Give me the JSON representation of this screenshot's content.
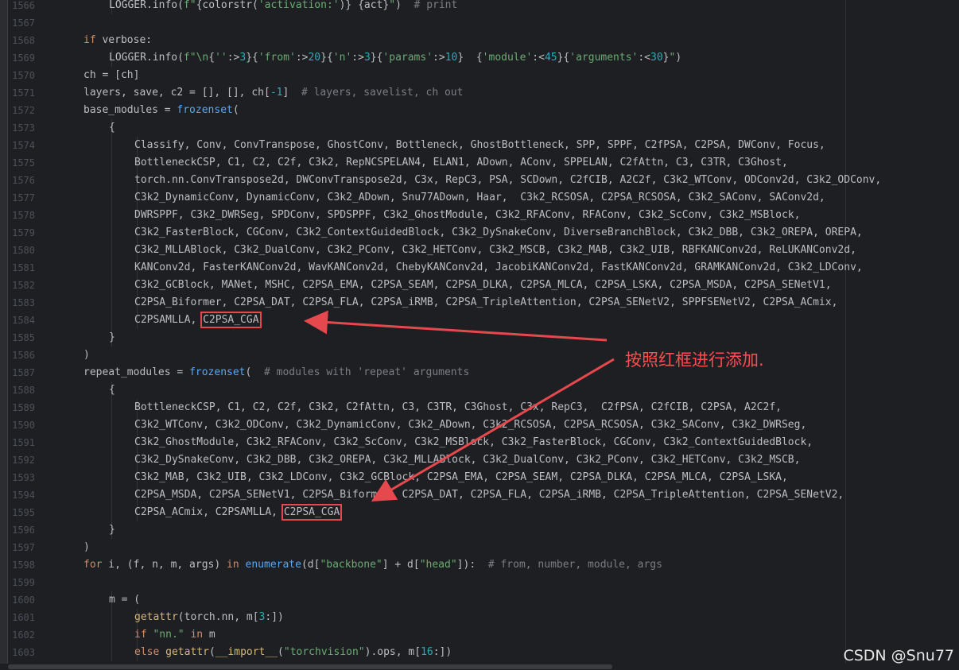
{
  "editor": {
    "lines": [
      {
        "n": "1566",
        "i": 2,
        "t": [
          [
            "LOGGER.info(",
            ""
          ],
          [
            "f\"",
            "s"
          ],
          [
            "{colorstr(",
            ""
          ],
          [
            "'activation:'",
            "s"
          ],
          [
            ")} {act}",
            ""
          ],
          [
            "\"",
            "s"
          ],
          [
            ")  ",
            ""
          ],
          [
            "# print",
            "c"
          ]
        ]
      },
      {
        "n": "1567",
        "i": 0,
        "t": []
      },
      {
        "n": "1568",
        "i": 1,
        "t": [
          [
            "if",
            "k"
          ],
          [
            " verbose:",
            ""
          ]
        ]
      },
      {
        "n": "1569",
        "i": 2,
        "t": [
          [
            "LOGGER.info(",
            ""
          ],
          [
            "f\"\\n",
            "s"
          ],
          [
            "{",
            ""
          ],
          [
            "''",
            "s"
          ],
          [
            ":>",
            ""
          ],
          [
            "3",
            "n"
          ],
          [
            "}{",
            ""
          ],
          [
            "'from'",
            "s"
          ],
          [
            ":>",
            ""
          ],
          [
            "20",
            "n"
          ],
          [
            "}{",
            ""
          ],
          [
            "'n'",
            "s"
          ],
          [
            ":>",
            ""
          ],
          [
            "3",
            "n"
          ],
          [
            "}{",
            ""
          ],
          [
            "'params'",
            "s"
          ],
          [
            ":>",
            ""
          ],
          [
            "10",
            "n"
          ],
          [
            "}  {",
            ""
          ],
          [
            "'module'",
            "s"
          ],
          [
            ":<",
            ""
          ],
          [
            "45",
            "n"
          ],
          [
            "}{",
            ""
          ],
          [
            "'arguments'",
            "s"
          ],
          [
            ":<",
            ""
          ],
          [
            "30",
            "n"
          ],
          [
            "}",
            ""
          ],
          [
            "\"",
            "s"
          ],
          [
            ")",
            ""
          ]
        ]
      },
      {
        "n": "1570",
        "i": 1,
        "t": [
          [
            "ch = [ch]",
            ""
          ]
        ]
      },
      {
        "n": "1571",
        "i": 1,
        "t": [
          [
            "layers, save, c2 = [], [], ch[",
            ""
          ],
          [
            "-1",
            "n"
          ],
          [
            "]  ",
            ""
          ],
          [
            "# layers, savelist, ch out",
            "c"
          ]
        ]
      },
      {
        "n": "1572",
        "i": 1,
        "t": [
          [
            "base_modules = ",
            ""
          ],
          [
            "frozenset",
            "b"
          ],
          [
            "(",
            ""
          ]
        ]
      },
      {
        "n": "1573",
        "i": 2,
        "t": [
          [
            "{",
            ""
          ]
        ]
      },
      {
        "n": "1574",
        "i": 3,
        "t": [
          [
            "Classify, Conv, ConvTranspose, GhostConv, Bottleneck, GhostBottleneck, SPP, SPPF, C2fPSA, C2PSA, DWConv, Focus,",
            ""
          ]
        ]
      },
      {
        "n": "1575",
        "i": 3,
        "t": [
          [
            "BottleneckCSP, C1, C2, C2f, C3k2, RepNCSPELAN4, ELAN1, ADown, AConv, SPPELAN, C2fAttn, C3, C3TR, C3Ghost,",
            ""
          ]
        ]
      },
      {
        "n": "1576",
        "i": 3,
        "t": [
          [
            "torch.nn.ConvTranspose2d, DWConvTranspose2d, C3x, RepC3, PSA, SCDown, C2fCIB, A2C2f, C3k2_WTConv, ODConv2d, C3k2_ODConv,",
            ""
          ]
        ]
      },
      {
        "n": "1577",
        "i": 3,
        "t": [
          [
            "C3k2_DynamicConv, DynamicConv, C3k2_ADown, Snu77ADown, Haar,  C3k2_RCSOSA, C2PSA_RCSOSA, C3k2_SAConv, SAConv2d,",
            ""
          ]
        ]
      },
      {
        "n": "1578",
        "i": 3,
        "t": [
          [
            "DWRSPPF, C3k2_DWRSeg, SPDConv, SPDSPPF, C3k2_GhostModule, C3k2_RFAConv, RFAConv, C3k2_ScConv, C3k2_MSBlock,",
            ""
          ]
        ]
      },
      {
        "n": "1579",
        "i": 3,
        "t": [
          [
            "C3k2_FasterBlock, CGConv, C3k2_ContextGuidedBlock, C3k2_DySnakeConv, DiverseBranchBlock, C3k2_DBB, C3k2_OREPA, OREPA,",
            ""
          ]
        ]
      },
      {
        "n": "1580",
        "i": 3,
        "t": [
          [
            "C3k2_MLLABlock, C3k2_DualConv, C3k2_PConv, C3k2_HETConv, C3k2_MSCB, C3k2_MAB, C3k2_UIB, RBFKANConv2d, ReLUKANConv2d,",
            ""
          ]
        ]
      },
      {
        "n": "1581",
        "i": 3,
        "t": [
          [
            "KANConv2d, FasterKANConv2d, WavKANConv2d, ChebyKANConv2d, JacobiKANConv2d, FastKANConv2d, GRAMKANConv2d, C3k2_LDConv,",
            ""
          ]
        ]
      },
      {
        "n": "1582",
        "i": 3,
        "t": [
          [
            "C3k2_GCBlock, MANet, MSHC, C2PSA_EMA, C2PSA_SEAM, C2PSA_DLKA, C2PSA_MLCA, C2PSA_LSKA, C2PSA_MSDA, C2PSA_SENetV1,",
            ""
          ]
        ]
      },
      {
        "n": "1583",
        "i": 3,
        "t": [
          [
            "C2PSA_Biformer, C2PSA_DAT, C2PSA_FLA, C2PSA_iRMB, C2PSA_TripleAttention, C2PSA_SENetV2, SPPFSENetV2, C2PSA_ACmix,",
            ""
          ]
        ]
      },
      {
        "n": "1584",
        "i": 3,
        "t": [
          [
            "C2PSAMLLA, ",
            ""
          ],
          [
            "C2PSA_CGA",
            "h"
          ]
        ]
      },
      {
        "n": "1585",
        "i": 2,
        "t": [
          [
            "}",
            ""
          ]
        ]
      },
      {
        "n": "1586",
        "i": 1,
        "t": [
          [
            ")",
            ""
          ]
        ]
      },
      {
        "n": "1587",
        "i": 1,
        "t": [
          [
            "repeat_modules = ",
            ""
          ],
          [
            "frozenset",
            "b"
          ],
          [
            "(  ",
            ""
          ],
          [
            "# modules with 'repeat' arguments",
            "c"
          ]
        ]
      },
      {
        "n": "1588",
        "i": 2,
        "t": [
          [
            "{",
            ""
          ]
        ]
      },
      {
        "n": "1589",
        "i": 3,
        "t": [
          [
            "BottleneckCSP, C1, C2, C2f, C3k2, C2fAttn, C3, C3TR, C3Ghost, C3x, RepC3,  C2fPSA, C2fCIB, C2PSA, A2C2f,",
            ""
          ]
        ]
      },
      {
        "n": "1590",
        "i": 3,
        "t": [
          [
            "C3k2_WTConv, C3k2_ODConv, C3k2_DynamicConv, C3k2_ADown, C3k2_RCSOSA, C2PSA_RCSOSA, C3k2_SAConv, C3k2_DWRSeg,",
            ""
          ]
        ]
      },
      {
        "n": "1591",
        "i": 3,
        "t": [
          [
            "C3k2_GhostModule, C3k2_RFAConv, C3k2_ScConv, C3k2_MSBlock, C3k2_FasterBlock, CGConv, C3k2_ContextGuidedBlock,",
            ""
          ]
        ]
      },
      {
        "n": "1592",
        "i": 3,
        "t": [
          [
            "C3k2_DySnakeConv, C3k2_DBB, C3k2_OREPA, C3k2_MLLABlock, C3k2_DualConv, C3k2_PConv, C3k2_HETConv, C3k2_MSCB,",
            ""
          ]
        ]
      },
      {
        "n": "1593",
        "i": 3,
        "t": [
          [
            "C3k2_MAB, C3k2_UIB, C3k2_LDConv, C3k2_GCBlock, C2PSA_EMA, C2PSA_SEAM, C2PSA_DLKA, C2PSA_MLCA, C2PSA_LSKA,",
            ""
          ]
        ]
      },
      {
        "n": "1594",
        "i": 3,
        "t": [
          [
            "C2PSA_MSDA, C2PSA_SENetV1, C2PSA_Biformer, C2PSA_DAT, C2PSA_FLA, C2PSA_iRMB, C2PSA_TripleAttention, C2PSA_SENetV2,",
            ""
          ]
        ]
      },
      {
        "n": "1595",
        "i": 3,
        "t": [
          [
            "C2PSA_ACmix, C2PSAMLLA, ",
            ""
          ],
          [
            "C2PSA_CGA",
            "h"
          ]
        ]
      },
      {
        "n": "1596",
        "i": 2,
        "t": [
          [
            "}",
            ""
          ]
        ]
      },
      {
        "n": "1597",
        "i": 1,
        "t": [
          [
            ")",
            ""
          ]
        ]
      },
      {
        "n": "1598",
        "i": 1,
        "t": [
          [
            "for",
            "k"
          ],
          [
            " i, (f, n, m, args) ",
            ""
          ],
          [
            "in",
            "k"
          ],
          [
            " ",
            ""
          ],
          [
            "enumerate",
            "b"
          ],
          [
            "(d[",
            ""
          ],
          [
            "\"backbone\"",
            "s"
          ],
          [
            "] + d[",
            ""
          ],
          [
            "\"head\"",
            "s"
          ],
          [
            "]):  ",
            ""
          ],
          [
            "# from, number, module, args",
            "c"
          ]
        ]
      },
      {
        "n": "1599",
        "i": 0,
        "t": []
      },
      {
        "n": "1600",
        "i": 2,
        "t": [
          [
            "m = (",
            ""
          ]
        ]
      },
      {
        "n": "1601",
        "i": 3,
        "t": [
          [
            "getattr",
            "y"
          ],
          [
            "(torch.nn, m[",
            ""
          ],
          [
            "3",
            "n"
          ],
          [
            ":])",
            ""
          ]
        ]
      },
      {
        "n": "1602",
        "i": 3,
        "t": [
          [
            "if",
            "k"
          ],
          [
            " ",
            ""
          ],
          [
            "\"nn.\"",
            "s"
          ],
          [
            " ",
            ""
          ],
          [
            "in",
            "k"
          ],
          [
            " m",
            ""
          ]
        ]
      },
      {
        "n": "1603",
        "i": 3,
        "t": [
          [
            "else",
            "k"
          ],
          [
            " ",
            ""
          ],
          [
            "getattr",
            "y"
          ],
          [
            "(",
            ""
          ],
          [
            "__import__",
            "y"
          ],
          [
            "(",
            ""
          ],
          [
            "\"torchvision\"",
            "s"
          ],
          [
            ").ops, m[",
            ""
          ],
          [
            "16",
            "n"
          ],
          [
            ":])",
            ""
          ]
        ]
      }
    ]
  },
  "annotation": {
    "text": "按照红框进行添加.",
    "color": "#ff4d4f"
  },
  "watermark": {
    "text": "CSDN @Snu77"
  }
}
